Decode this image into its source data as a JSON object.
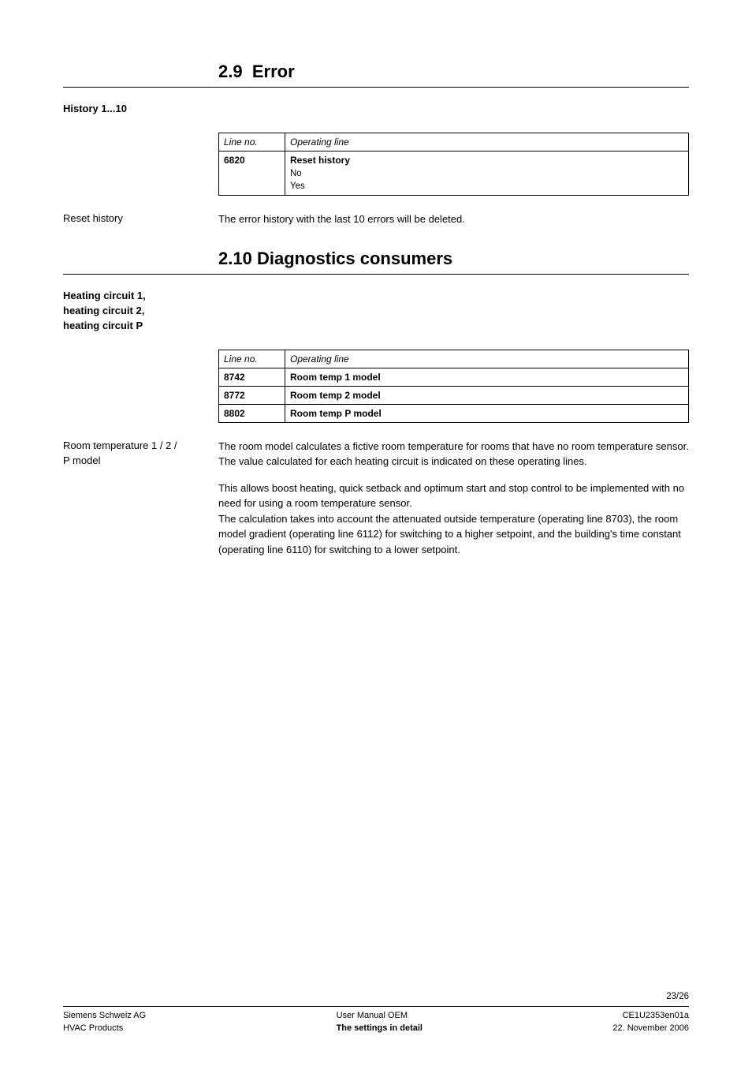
{
  "section1": {
    "number": "2.9",
    "title": "Error",
    "history_label": "History 1...10",
    "table": {
      "col_line_no": "Line no.",
      "col_operating": "Operating line",
      "rows": [
        {
          "line_no": "6820",
          "title": "Reset history",
          "sub": [
            "No",
            "Yes"
          ]
        }
      ]
    },
    "reset_label": "Reset history",
    "reset_text": "The error history with the last 10 errors will be deleted."
  },
  "section2": {
    "number": "2.10",
    "title": "Diagnostics consumers",
    "heating_label": [
      "Heating circuit 1,",
      "heating circuit 2,",
      "heating circuit P"
    ],
    "table": {
      "col_line_no": "Line no.",
      "col_operating": "Operating line",
      "rows": [
        {
          "line_no": "8742",
          "title": "Room temp 1 model"
        },
        {
          "line_no": "8772",
          "title": "Room temp 2 model"
        },
        {
          "line_no": "8802",
          "title": "Room temp P model"
        }
      ]
    },
    "room_label": [
      "Room temperature 1 / 2 /",
      "P model"
    ],
    "para1": "The room model calculates a fictive room temperature for rooms that have no room temperature sensor. The value calculated for each heating circuit is indicated on these operating lines.",
    "para2": "This allows boost heating, quick setback and optimum start and stop control to be implemented with no need for using a room temperature sensor.\nThe calculation takes into account the attenuated outside temperature (operating line 8703), the room model gradient (operating line 6112) for switching to a higher setpoint, and the building's time constant (operating line 6110) for switching to a lower setpoint."
  },
  "footer": {
    "page_num": "23/26",
    "left1": "Siemens Schweiz AG",
    "left2": "HVAC Products",
    "center1": "User Manual OEM",
    "center2": "The settings in detail",
    "right1": "CE1U2353en01a",
    "right2": "22. November 2006"
  }
}
